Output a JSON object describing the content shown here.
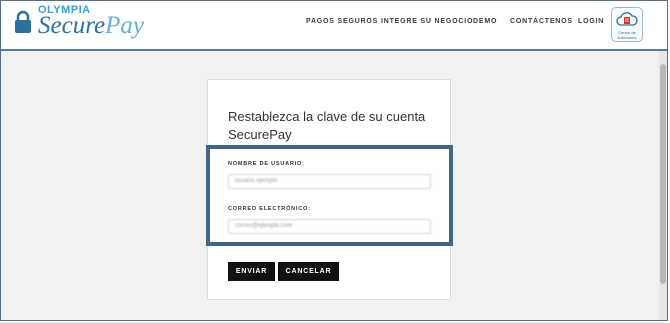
{
  "brand": {
    "company": "OLYMPIA",
    "name_part1": "Secure",
    "name_part2": "Pay"
  },
  "nav": {
    "items": [
      "PAGOS SEGUROS",
      "INTEGRE SU NEGOCIO",
      "DEMO",
      "CONTÁCTENOS",
      "LOGIN"
    ],
    "help_label": "Centro de soluciones"
  },
  "form": {
    "title": "Restablezca la clave de su cuenta SecurePay",
    "username_label": "NOMBRE DE USUARIO:",
    "username_value": "usuario.ejemplo",
    "email_label": "CORREO ELECTRÓNICO:",
    "email_value": "correo@ejemplo.com",
    "submit_label": "ENVIAR",
    "cancel_label": "CANCELAR"
  },
  "colors": {
    "brand_blue": "#2f6f9e",
    "highlight_border": "#3f6587",
    "button_bg": "#111111"
  }
}
